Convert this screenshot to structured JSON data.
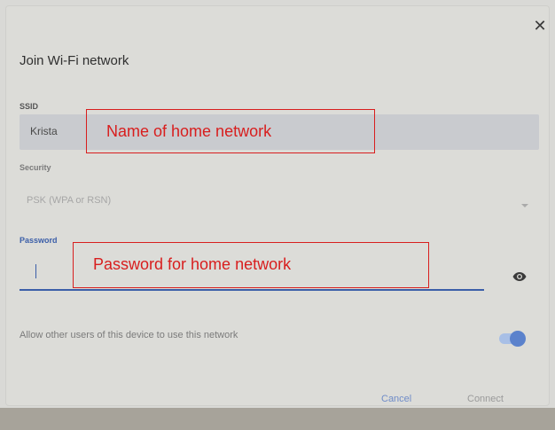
{
  "dialog": {
    "title": "Join Wi-Fi network",
    "close_icon": "close-icon"
  },
  "ssid": {
    "label": "SSID",
    "value": "Krista"
  },
  "security": {
    "label": "Security",
    "value": "PSK (WPA or RSN)"
  },
  "password": {
    "label": "Password",
    "value": "",
    "visibility_icon": "eye-icon"
  },
  "sharing": {
    "label": "Allow other users of this device to use this network",
    "enabled": true
  },
  "buttons": {
    "cancel": "Cancel",
    "connect": "Connect"
  },
  "annotations": {
    "ssid_note": "Name of home network",
    "password_note": "Password for home network",
    "color": "#d81e1e"
  },
  "colors": {
    "accent": "#3b5ea8"
  }
}
